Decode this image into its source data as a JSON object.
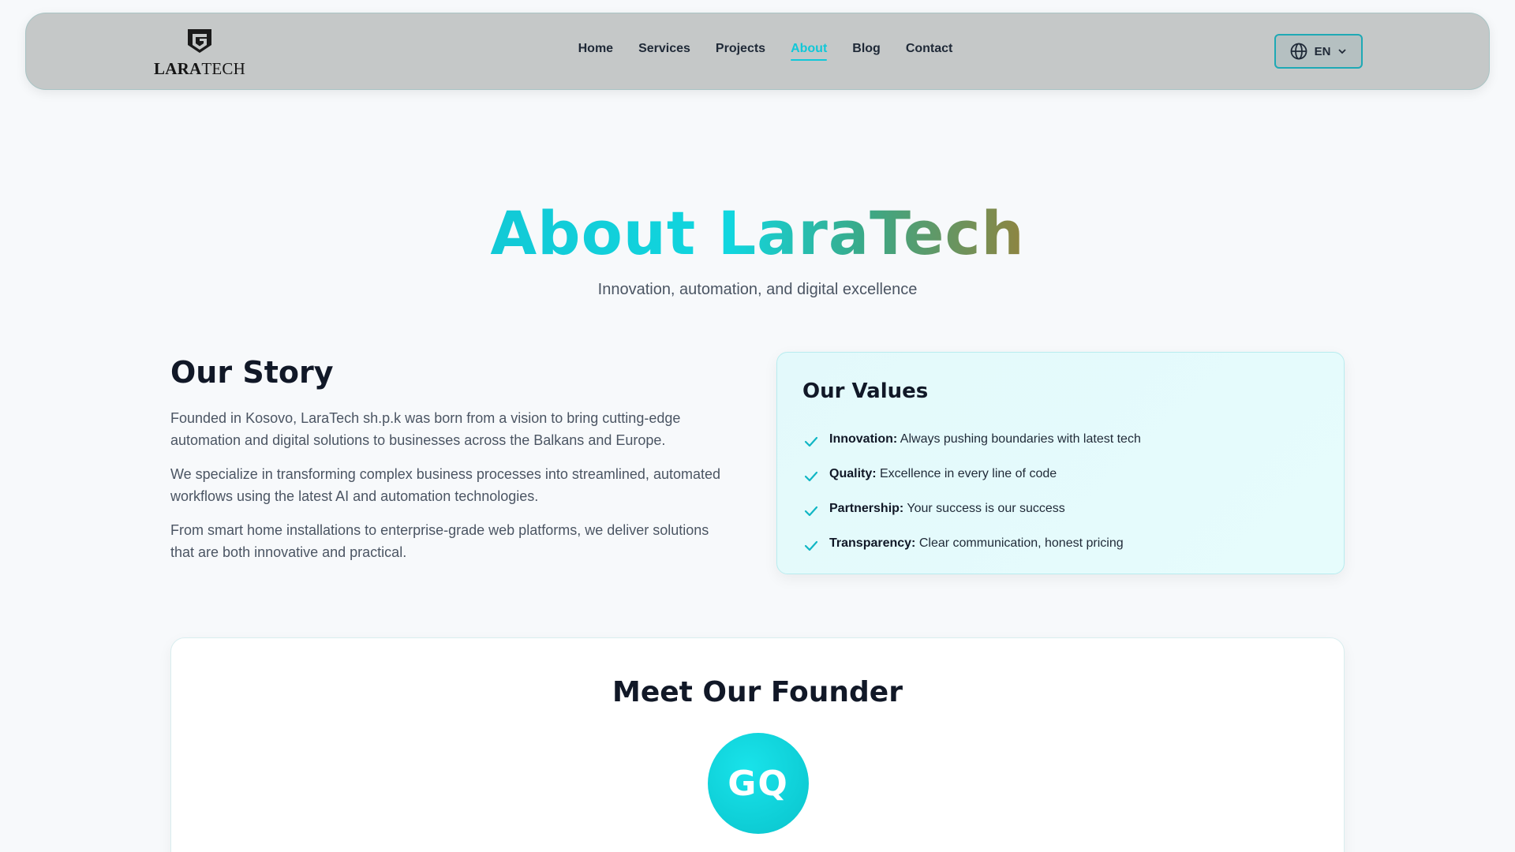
{
  "brand": {
    "name_part1": "LARA",
    "name_part2": "TECH"
  },
  "nav": {
    "links": [
      {
        "label": "Home",
        "active": false
      },
      {
        "label": "Services",
        "active": false
      },
      {
        "label": "Projects",
        "active": false
      },
      {
        "label": "About",
        "active": true
      },
      {
        "label": "Blog",
        "active": false
      },
      {
        "label": "Contact",
        "active": false
      }
    ],
    "language": {
      "label": "EN",
      "icon": "globe-icon"
    }
  },
  "hero": {
    "title": "About LaraTech",
    "subtitle": "Innovation, automation, and digital excellence"
  },
  "story": {
    "heading": "Our Story",
    "paragraphs": [
      "Founded in Kosovo, LaraTech sh.p.k was born from a vision to bring cutting-edge automation and digital solutions to businesses across the Balkans and Europe.",
      "We specialize in transforming complex business processes into streamlined, automated workflows using the latest AI and automation technologies.",
      "From smart home installations to enterprise-grade web platforms, we deliver solutions that are both innovative and practical."
    ]
  },
  "values": {
    "heading": "Our Values",
    "items": [
      {
        "name": "Innovation:",
        "text": " Always pushing boundaries with latest tech"
      },
      {
        "name": "Quality:",
        "text": " Excellence in every line of code"
      },
      {
        "name": "Partnership:",
        "text": " Your success is our success"
      },
      {
        "name": "Transparency:",
        "text": " Clear communication, honest pricing"
      }
    ]
  },
  "founder": {
    "heading": "Meet Our Founder",
    "initials": "GQ"
  },
  "colors": {
    "accent": "#11c8d8",
    "page_bg": "#f7f9fb",
    "navbar_bg": "#c5c8c8",
    "values_bg": "#e3f9fb"
  }
}
